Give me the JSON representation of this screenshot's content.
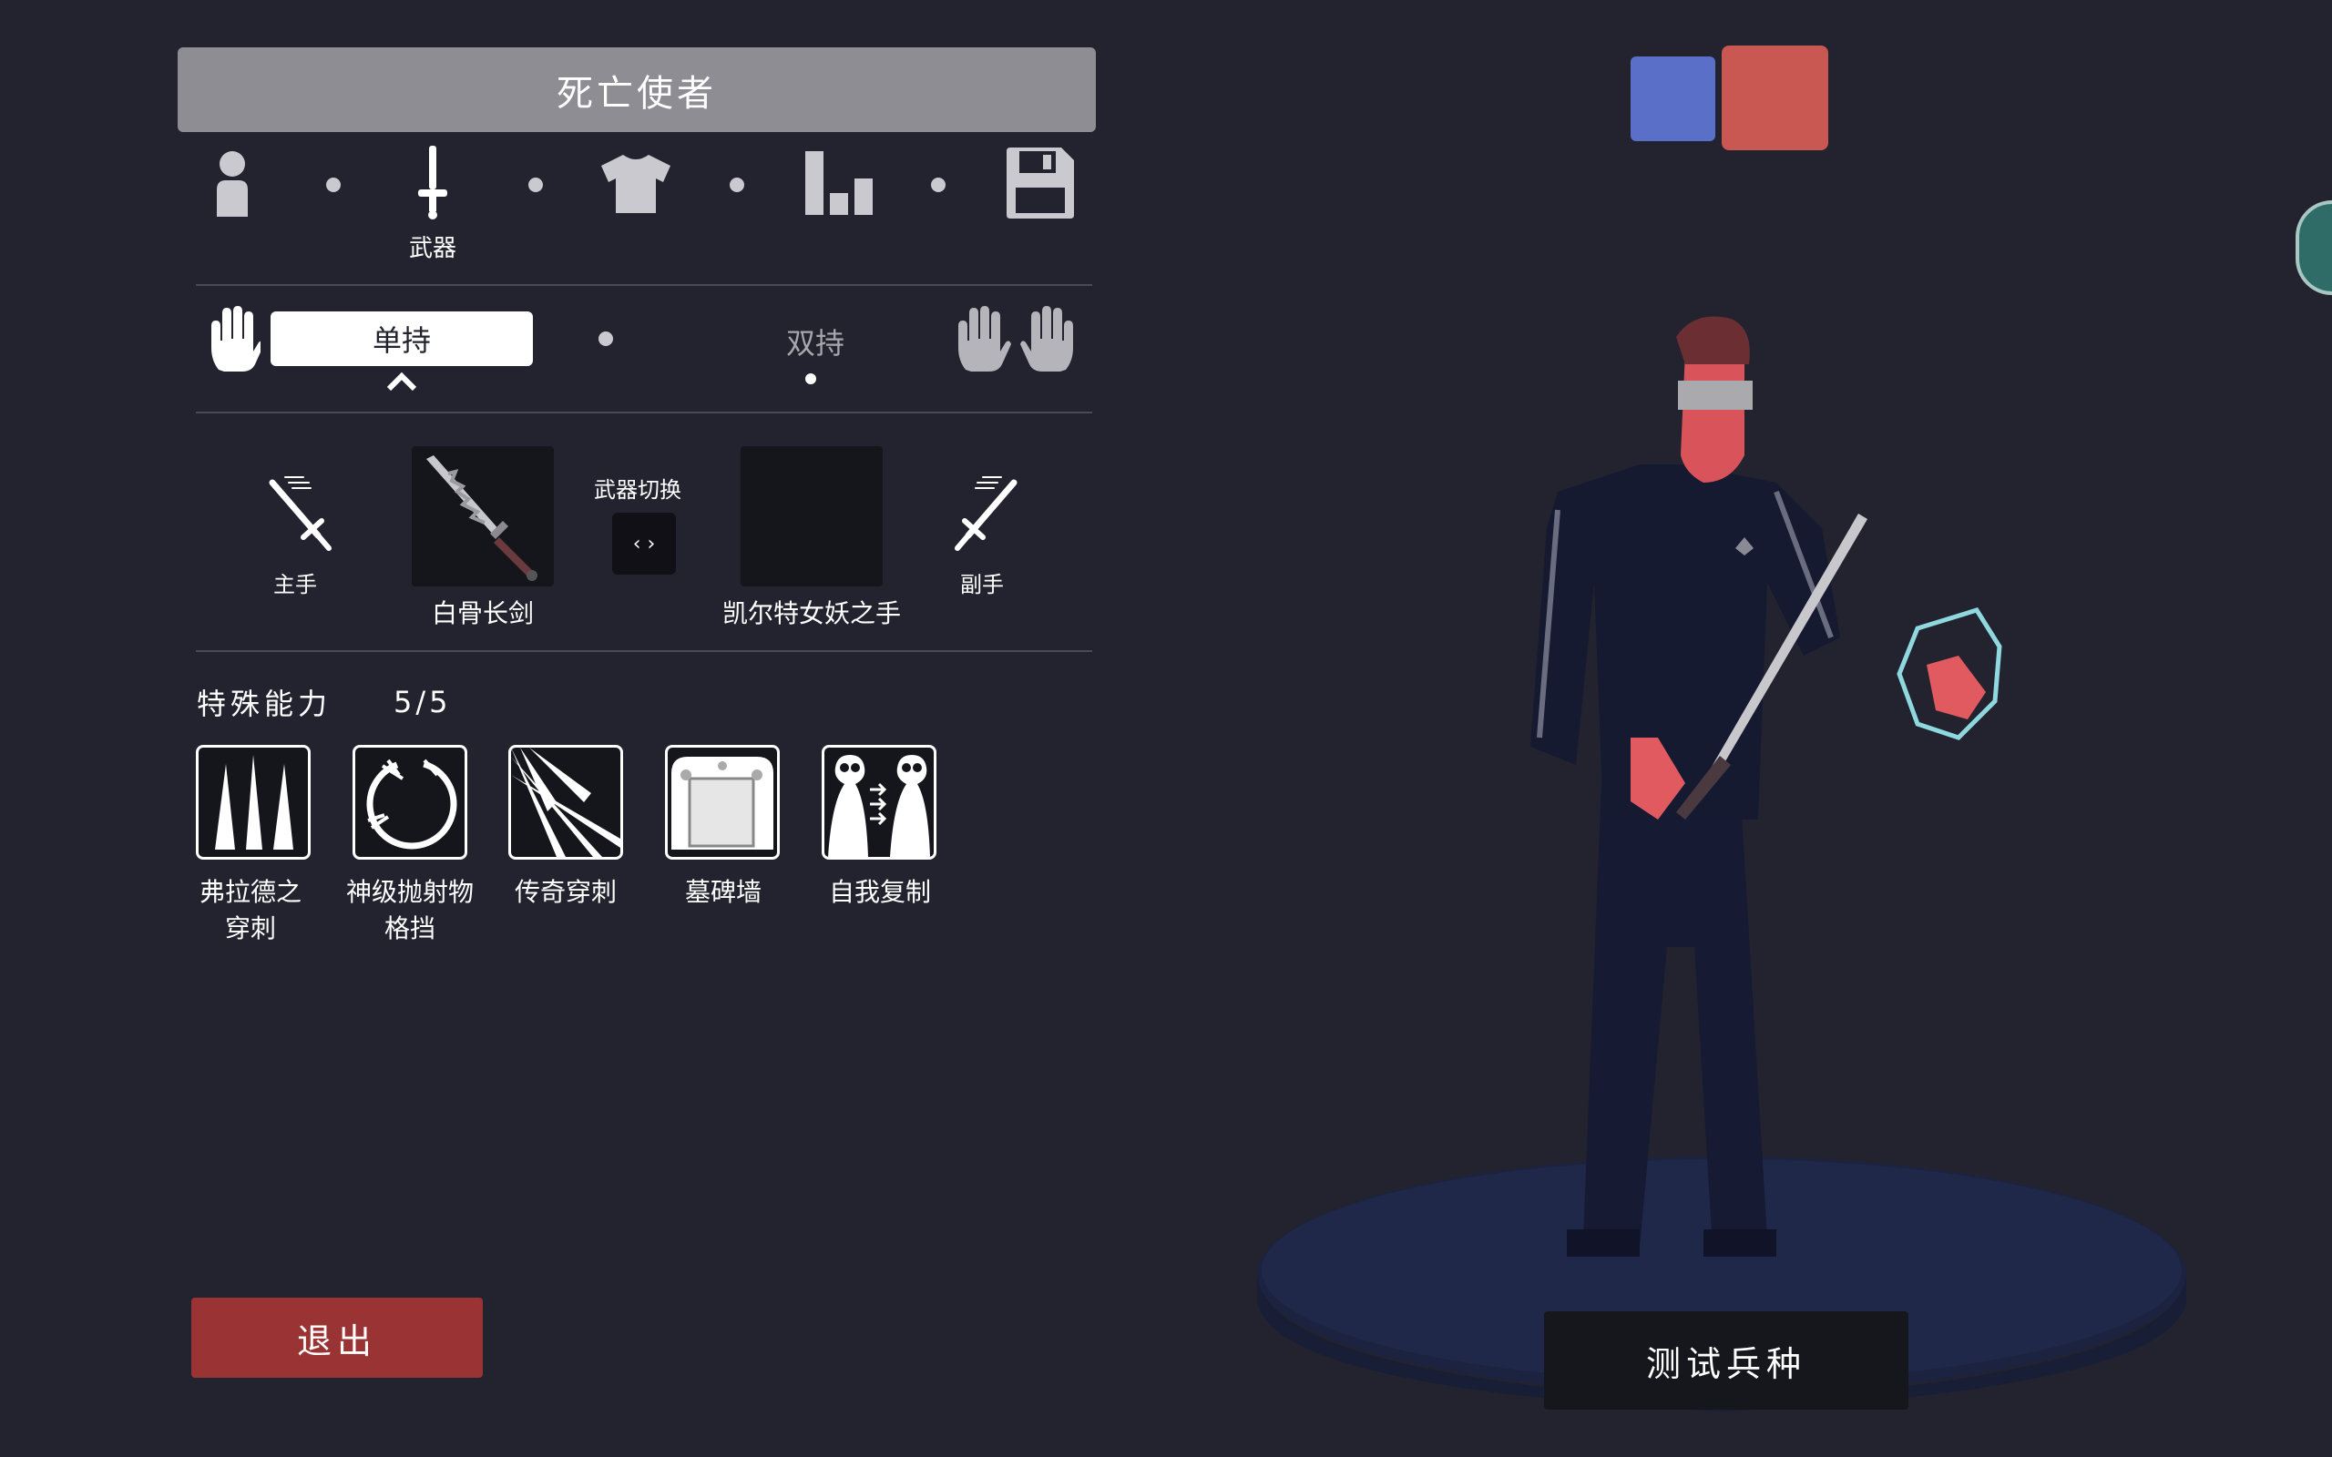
{
  "header": {
    "unit_name": "死亡使者"
  },
  "nav": {
    "tabs": [
      {
        "icon": "person-icon",
        "label": ""
      },
      {
        "icon": "sword-icon",
        "label": "武器"
      },
      {
        "icon": "shirt-icon",
        "label": ""
      },
      {
        "icon": "stats-icon",
        "label": ""
      },
      {
        "icon": "save-icon",
        "label": ""
      }
    ],
    "active_index": 1
  },
  "grip": {
    "single": "单持",
    "dual": "双持",
    "selected": "single"
  },
  "weapons": {
    "main_hand_label": "主手",
    "main_weapon": "白骨长剑",
    "switch_label": "武器切换",
    "switch_glyph": "‹ ›",
    "off_weapon": "凯尔特女妖之手",
    "off_hand_label": "副手"
  },
  "abilities": {
    "title": "特殊能力",
    "count": "5/5",
    "items": [
      {
        "label": "弗拉德之穿刺",
        "icon": "spikes-icon"
      },
      {
        "label": "神级抛射物格挡",
        "icon": "projectile-block-icon"
      },
      {
        "label": "传奇穿刺",
        "icon": "legendary-pierce-icon"
      },
      {
        "label": "墓碑墙",
        "icon": "tombstone-wall-icon"
      },
      {
        "label": "自我复制",
        "icon": "self-clone-icon"
      }
    ]
  },
  "buttons": {
    "exit": "退出",
    "test_unit": "测试兵种"
  },
  "colors": {
    "team_blue": "#5a6fc8",
    "team_red": "#c95752",
    "background": "#23232f",
    "exit_red": "#9a3333"
  }
}
